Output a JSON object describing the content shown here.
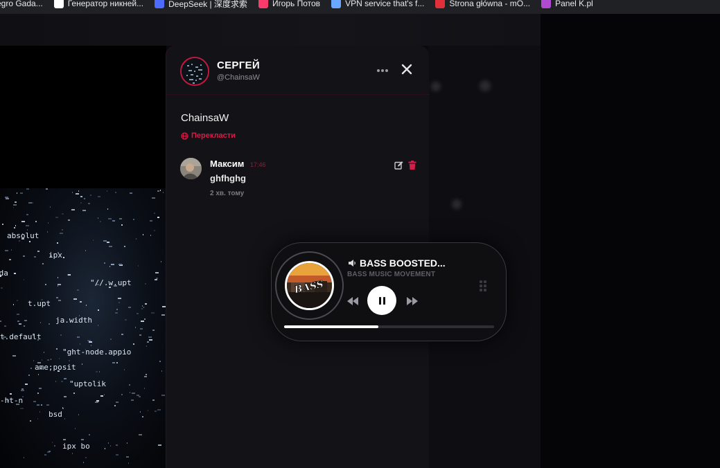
{
  "bookmarks": [
    {
      "label": "egro Gada...",
      "icon": "allegro-icon",
      "color": "#ff5a00"
    },
    {
      "label": "Генератор никней...",
      "icon": "fingerprint-icon",
      "color": "#ffffff"
    },
    {
      "label": "DeepSeek | 深度求索",
      "icon": "deepseek-icon",
      "color": "#4d6bfe"
    },
    {
      "label": "Игорь Потов",
      "icon": "play-icon",
      "color": "#ff3b6b"
    },
    {
      "label": "VPN service that's f...",
      "icon": "vpn-icon",
      "color": "#6aa8ff"
    },
    {
      "label": "Strona główna - mO...",
      "icon": "shop-icon",
      "color": "#e0303a"
    },
    {
      "label": "Panel K.pl",
      "icon": "panel-icon",
      "color": "#b04ad0"
    }
  ],
  "profile": {
    "name": "СЕРГЕЙ",
    "handle": "@ChainsaW",
    "display_name": "ChainsaW",
    "translate_label": "Перекласти",
    "accent": "#d31e4b"
  },
  "comment": {
    "author": "Максим",
    "time": "17:46",
    "text": "ghfhghg",
    "ago": "2 хв. тому"
  },
  "player": {
    "title": "BASS BOOSTED...",
    "artist": "BASS MUSIC MOVEMENT",
    "cover_text": "BASS",
    "progress": 0.45,
    "state": "playing"
  },
  "matrix_words": [
    "absolut",
    "ipx",
    "xda",
    "\"//.w.upt",
    "t.upt",
    "ja.width",
    "t.default",
    "\"ght-node.appio",
    "ame;posit",
    "\"uptolik",
    "-ht-n",
    "bsd",
    "ipx bo"
  ]
}
